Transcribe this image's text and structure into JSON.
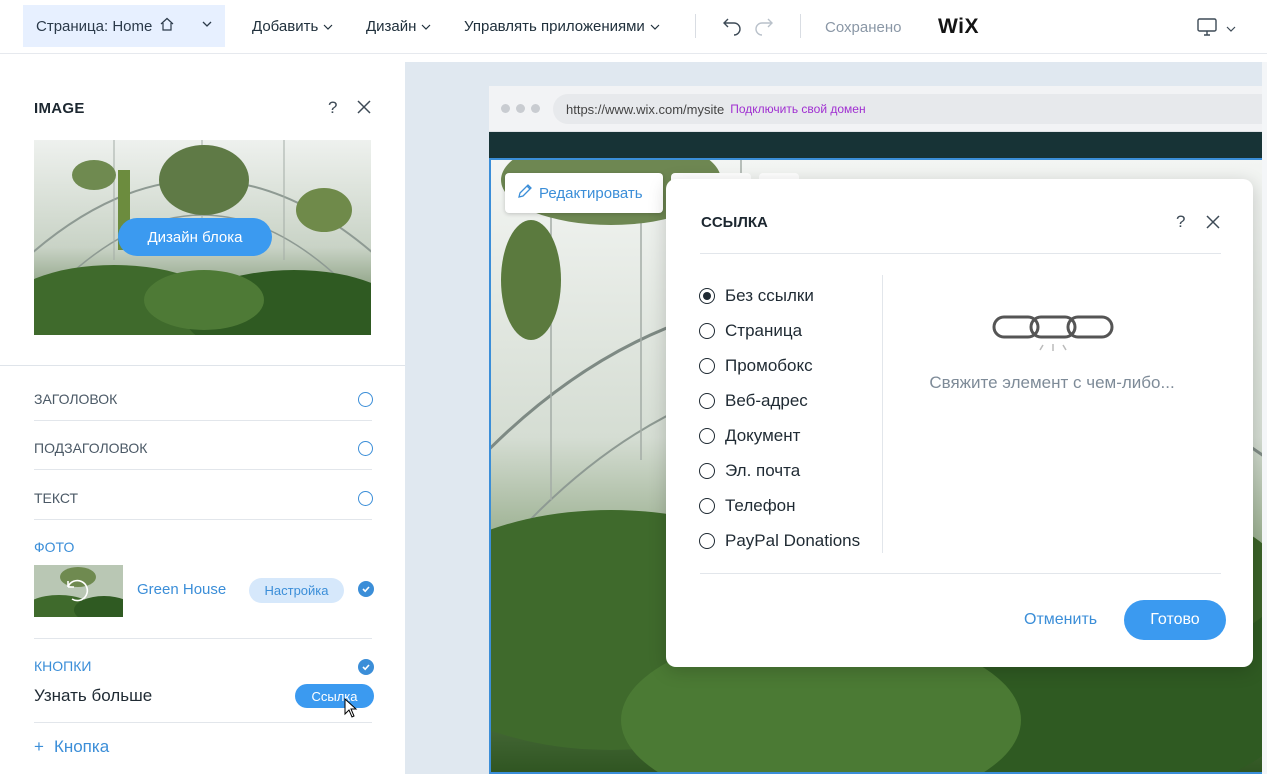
{
  "topbar": {
    "page_select": "Страница: Home",
    "menu": [
      "Добавить",
      "Дизайн",
      "Управлять приложениями"
    ],
    "saved": "Сохранено",
    "logo": "WiX"
  },
  "panel": {
    "title": "IMAGE",
    "help": "?",
    "design_button": "Дизайн блока",
    "sections": {
      "heading": "ЗАГОЛОВОК",
      "subheading": "ПОДЗАГОЛОВОК",
      "text": "ТЕКСТ",
      "photo": "ФОТО",
      "buttons": "КНОПКИ"
    },
    "photo": {
      "name": "Green House",
      "setup": "Настройка"
    },
    "button_item": {
      "label": "Узнать больше",
      "link": "Ссылка"
    },
    "add_button": {
      "plus": "+",
      "label": "Кнопка"
    }
  },
  "browser": {
    "url": "https://www.wix.com/mysite",
    "connect": "Подключить свой домен"
  },
  "edit_button": "Редактировать",
  "modal": {
    "title": "ССЫЛКА",
    "help": "?",
    "options": [
      "Без ссылки",
      "Страница",
      "Промобокс",
      "Веб-адрес",
      "Документ",
      "Эл. почта",
      "Телефон",
      "PayPal Donations"
    ],
    "selected_index": 0,
    "hint": "Свяжите элемент с чем-либо...",
    "cancel": "Отменить",
    "done": "Готово"
  },
  "colors": {
    "accent": "#3b9af0",
    "accent_text": "#3b8ed8",
    "domain_link": "#a02fd1",
    "site_header": "#173336"
  }
}
